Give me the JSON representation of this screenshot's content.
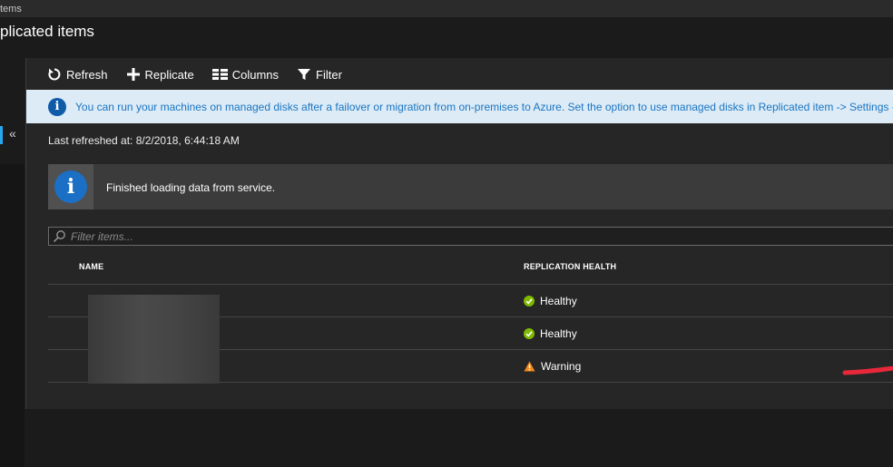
{
  "breadcrumb": {
    "text": "tems"
  },
  "page": {
    "title": "plicated items"
  },
  "rail": {
    "collapse_glyph": "«"
  },
  "toolbar": {
    "refresh_label": "Refresh",
    "replicate_label": "Replicate",
    "columns_label": "Columns",
    "filter_label": "Filter"
  },
  "info_banner": {
    "text": "You can run your machines on managed disks after a failover or migration from on-premises to Azure. Set the option to use managed disks in Replicated item -> Settings -"
  },
  "last_refreshed": "Last refreshed at: 8/2/2018, 6:44:18 AM",
  "notice": {
    "text": "Finished loading data from service."
  },
  "filter": {
    "placeholder": "Filter items..."
  },
  "table": {
    "headers": {
      "name": "NAME",
      "health": "REPLICATION HEALTH"
    },
    "rows": [
      {
        "health": "Healthy",
        "status": "healthy"
      },
      {
        "health": "Healthy",
        "status": "healthy"
      },
      {
        "health": "Warning",
        "status": "warning"
      }
    ]
  },
  "colors": {
    "accent": "#2aa6f0",
    "info_text": "#1b75c2",
    "healthy": "#7fba00",
    "warning": "#f38a1d",
    "annotation": "#e8283a"
  },
  "icons": {
    "refresh": "refresh-icon",
    "replicate": "plus-icon",
    "columns": "columns-icon",
    "filter": "funnel-icon",
    "info": "info-icon",
    "search": "search-icon",
    "healthy": "check-circle-icon",
    "warning": "warning-triangle-icon"
  }
}
